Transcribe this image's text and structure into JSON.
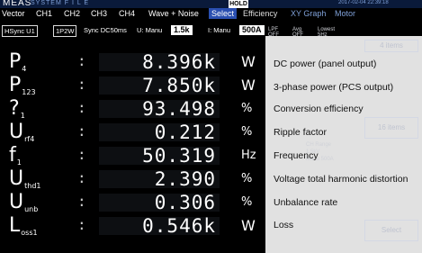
{
  "header": {
    "title": "MEAS",
    "menu": "SYSTEM  F I L E",
    "hold_label": "HOLD",
    "datetime": "2017-02-04 22:39:18"
  },
  "tabs": [
    "Vector",
    "CH1",
    "CH2",
    "CH3",
    "CH4",
    "Wave + Noise",
    "Select",
    "Efficiency",
    "XY Graph",
    "Motor"
  ],
  "selected_tab": "Select",
  "status": {
    "hsync": "HSync U1",
    "wiring": "1P2W",
    "sync": "Sync DC50ms",
    "u_label": "U: Manu",
    "u_value": "1.5k",
    "i_label": "I: Manu",
    "i_value": "500A"
  },
  "measurements": [
    {
      "symbol": "P",
      "sub": "4",
      "value": "8.396k",
      "unit": "W",
      "description": "DC power (panel output)"
    },
    {
      "symbol": "P",
      "sub": "123",
      "value": "7.850k",
      "unit": "W",
      "description": "3-phase power (PCS output)"
    },
    {
      "symbol": "?",
      "sub": "1",
      "value": "93.498",
      "unit": "%",
      "description": "Conversion efficiency"
    },
    {
      "symbol": "U",
      "sub": "rf4",
      "value": "0.212",
      "unit": "%",
      "description": "Ripple factor"
    },
    {
      "symbol": "f",
      "sub": "1",
      "value": "50.319",
      "unit": "Hz",
      "description": "Frequency"
    },
    {
      "symbol": "U",
      "sub": "thd1",
      "value": "2.390",
      "unit": "%",
      "description": "Voltage total harmonic distortion"
    },
    {
      "symbol": "U",
      "sub": "unb",
      "value": "0.306",
      "unit": "%",
      "description": "Unbalance rate"
    },
    {
      "symbol": "L",
      "sub": "oss1",
      "value": "0.546k",
      "unit": "W",
      "description": "Loss"
    }
  ],
  "right_panel": {
    "items_a": "4 items",
    "items_b": "16 items",
    "select_label": "Select",
    "ghost_texts": [
      "LPF",
      "Avg",
      "Lowest",
      "OFF",
      "OFF",
      "5Hz",
      "CH Range",
      "1.5kV",
      "Manu 500A"
    ]
  }
}
